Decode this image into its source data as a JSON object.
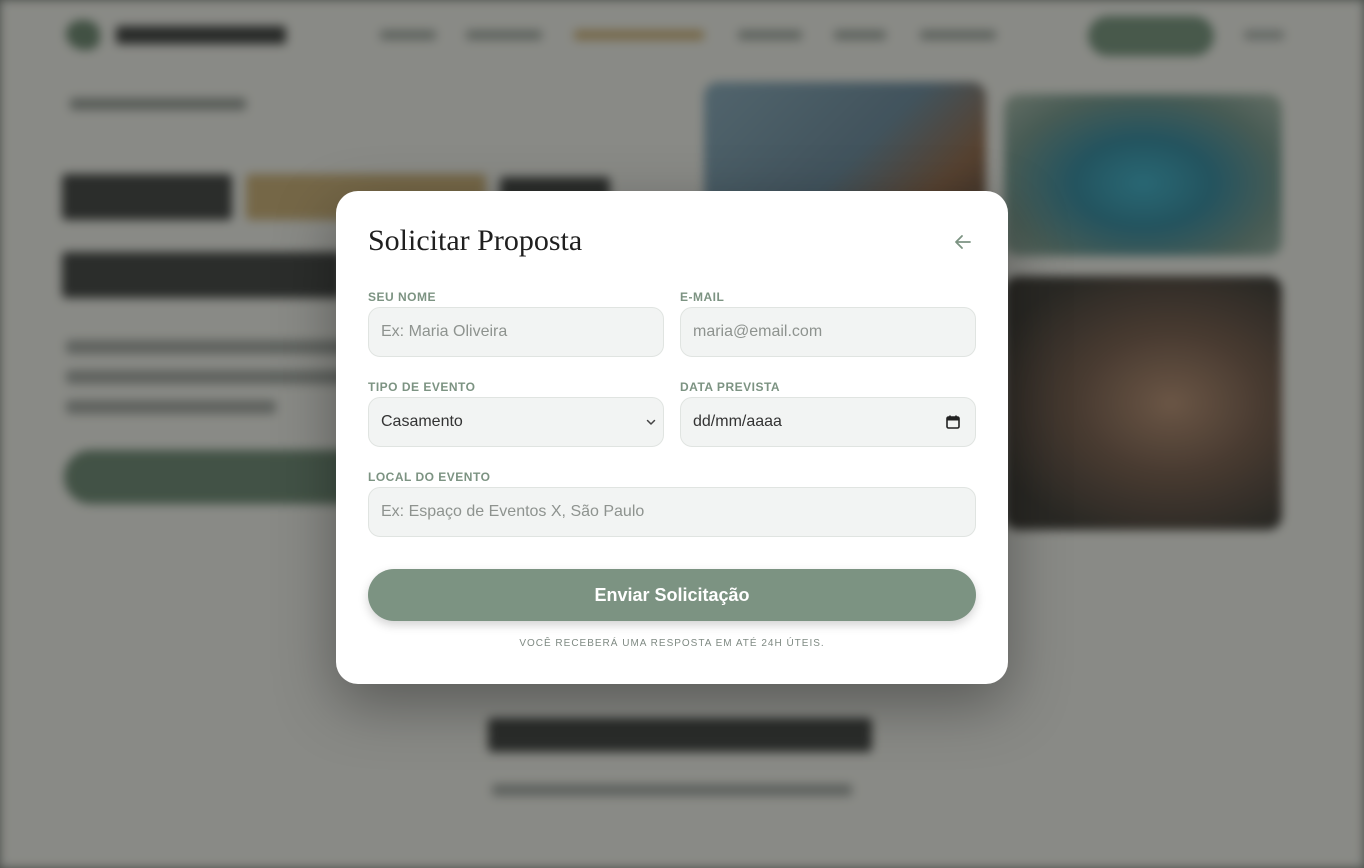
{
  "modal": {
    "title": "Solicitar Proposta",
    "back_icon": "arrow-left-icon",
    "fields": {
      "name": {
        "label": "SEU NOME",
        "placeholder": "Ex: Maria Oliveira",
        "value": ""
      },
      "email": {
        "label": "E-MAIL",
        "placeholder": "maria@email.com",
        "value": ""
      },
      "event_type": {
        "label": "TIPO DE EVENTO",
        "selected": "Casamento",
        "options": [
          "Casamento"
        ]
      },
      "date": {
        "label": "DATA PREVISTA",
        "placeholder": "dd/mm/aaaa",
        "value": ""
      },
      "location": {
        "label": "LOCAL DO EVENTO",
        "placeholder": "Ex: Espaço de Eventos X, São Paulo",
        "value": ""
      }
    },
    "submit_label": "Enviar Solicitação",
    "footnote": "VOCÊ RECEBERÁ UMA RESPOSTA EM ATÉ 24H ÚTEIS."
  },
  "colors": {
    "accent": "#7c9382",
    "label": "#7c9382",
    "modal_bg": "#ffffff",
    "field_bg": "#f2f4f3"
  }
}
